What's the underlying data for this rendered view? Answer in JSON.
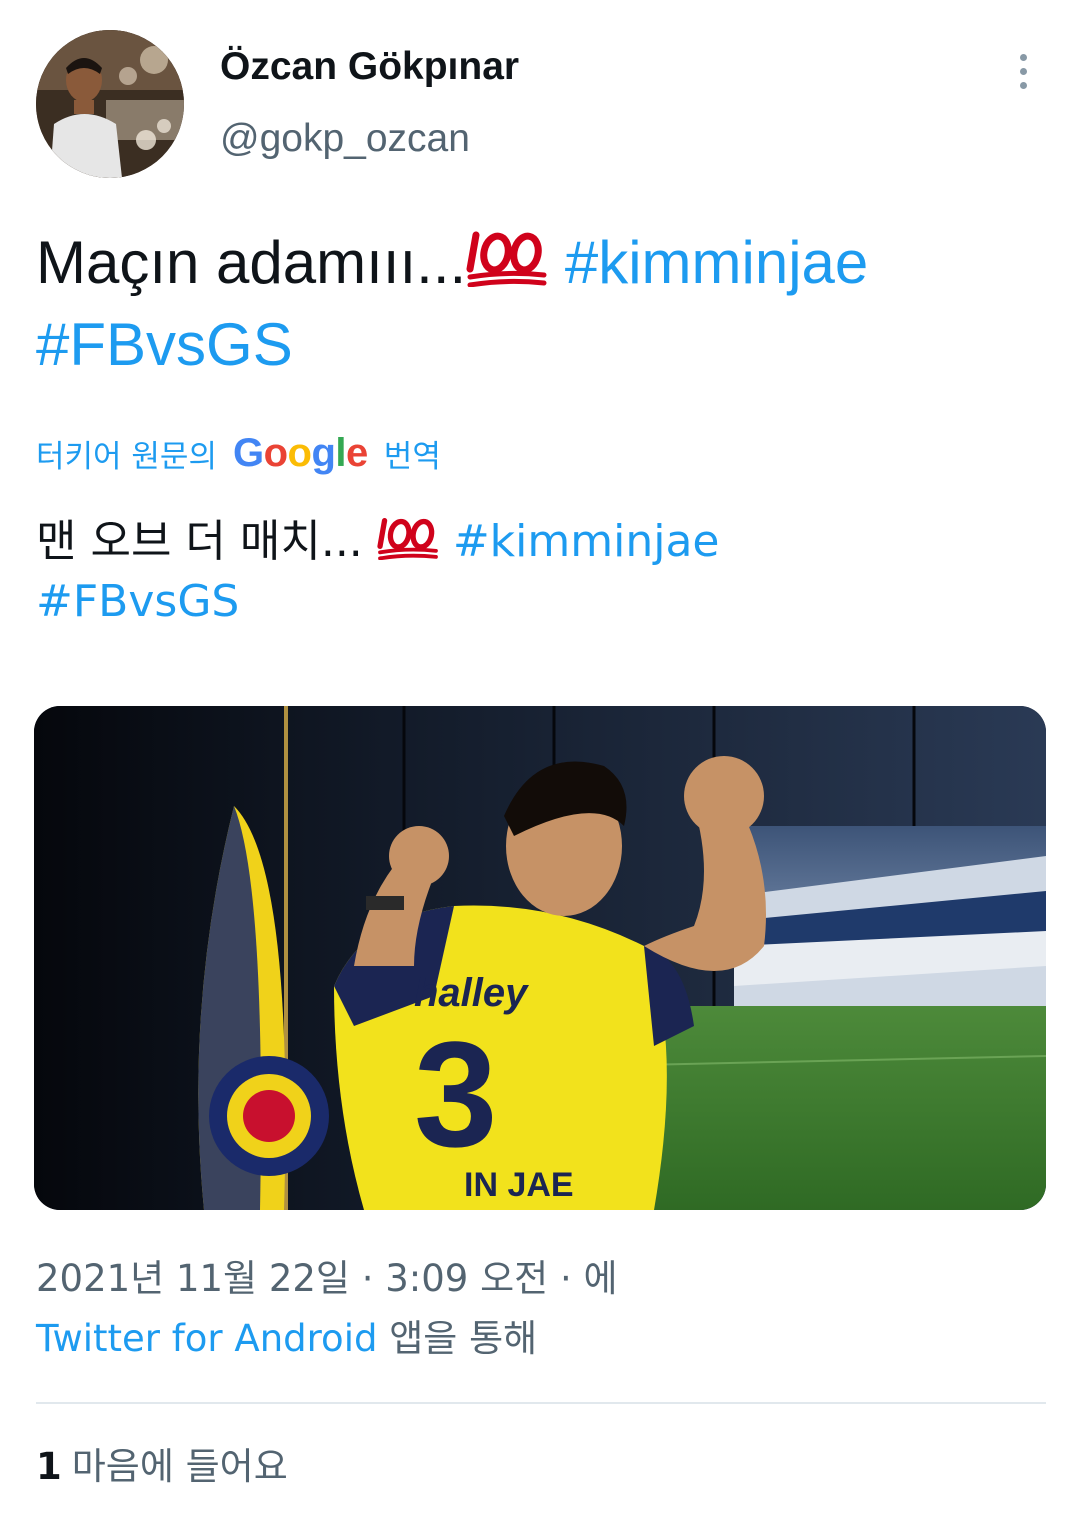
{
  "author": {
    "name": "Özcan Gökpınar",
    "handle": "@gokp_ozcan"
  },
  "tweet": {
    "text_plain": "Maçın adamııı...",
    "emoji": "100-emoji",
    "hashtag_1": "#kimminjae",
    "hashtag_2": "#FBvsGS"
  },
  "translation": {
    "prefix": "터키어 원문의",
    "google_letters": [
      "G",
      "o",
      "o",
      "g",
      "l",
      "e"
    ],
    "suffix": "번역",
    "text_plain": "맨 오브 더 매치...",
    "hashtag_1": "#kimminjae",
    "hashtag_2": "#FBvsGS"
  },
  "media": {
    "jersey_brand": "halley",
    "jersey_number": "3",
    "jersey_name": "IN JAE"
  },
  "meta": {
    "timestamp": "2021년 11월 22일 · 3:09 오전 · 에",
    "source_link": "Twitter for Android",
    "source_suffix": "앱을 통해"
  },
  "stats": {
    "likes_count": "1",
    "likes_label": "마음에 들어요"
  },
  "colors": {
    "link": "#1d9bf0",
    "secondary_text": "#536471",
    "primary_text": "#0f1419",
    "emoji_red": "#d0021b"
  },
  "icons": [
    "more-options-icon",
    "hundred-points-emoji-icon"
  ]
}
